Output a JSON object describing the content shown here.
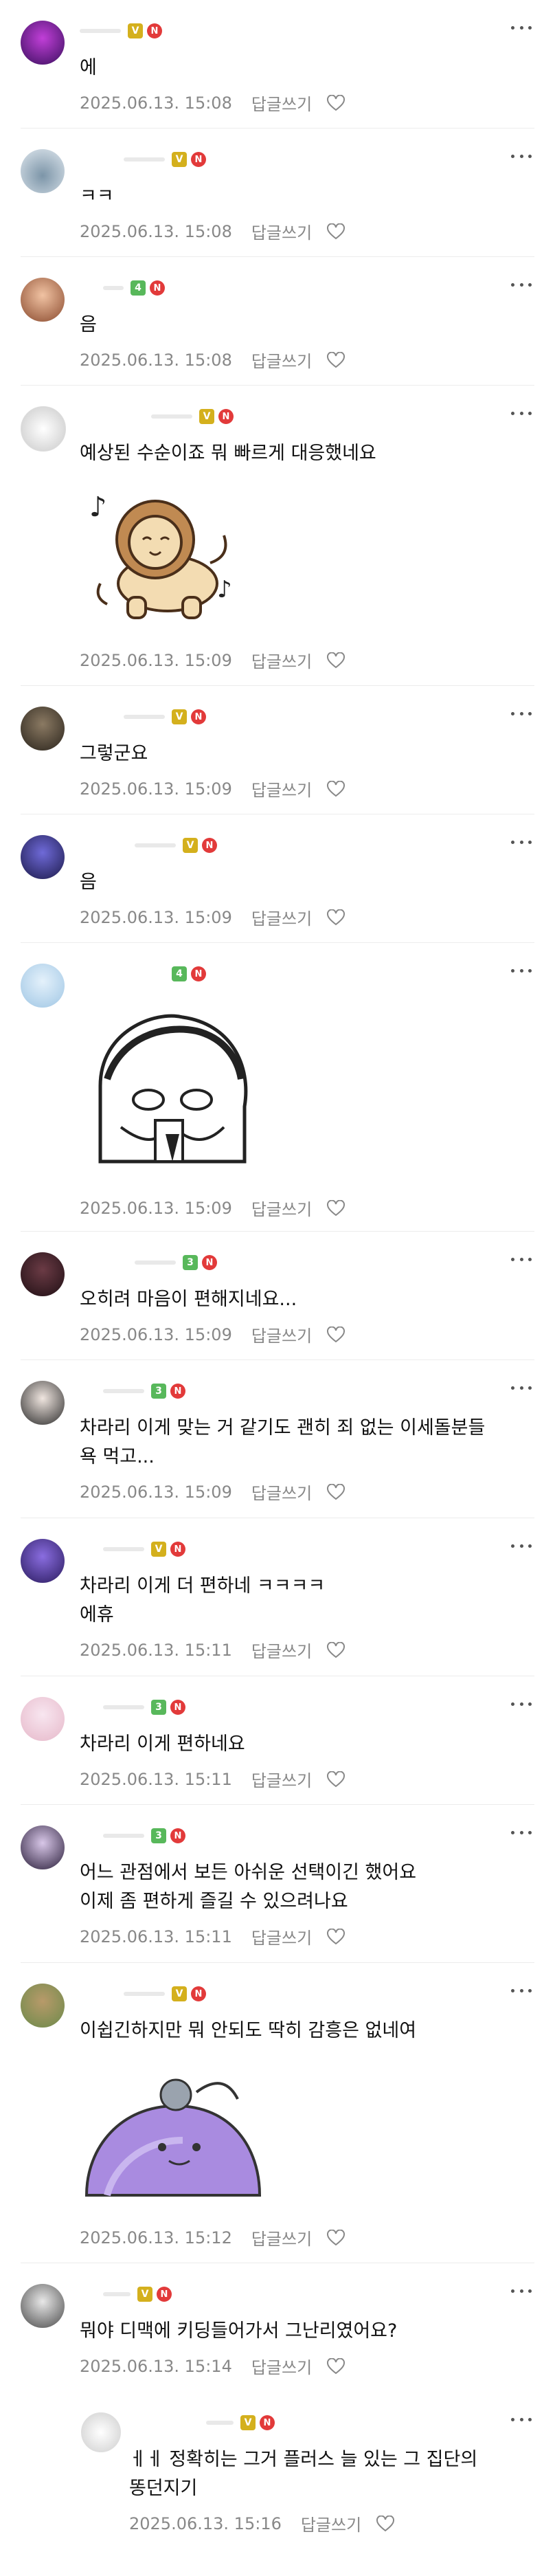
{
  "reply_label": "답글쓰기",
  "comments": [
    {
      "text": "에",
      "time": "2025.06.13. 15:08",
      "level": "V"
    },
    {
      "text": "ㅋㅋ",
      "time": "2025.06.13. 15:08",
      "level": "V"
    },
    {
      "text": "음",
      "time": "2025.06.13. 15:08",
      "level": "4"
    },
    {
      "text": "예상된 수순이죠 뭐 빠르게 대응했네요",
      "time": "2025.06.13. 15:09",
      "level": "V"
    },
    {
      "text": "그렇군요",
      "time": "2025.06.13. 15:09",
      "level": "V"
    },
    {
      "text": "음",
      "time": "2025.06.13. 15:09",
      "level": "V"
    },
    {
      "text": "",
      "time": "2025.06.13. 15:09",
      "level": "4"
    },
    {
      "text": "오히려 마음이 편해지네요...",
      "time": "2025.06.13. 15:09",
      "level": "3"
    },
    {
      "text": "차라리 이게 맞는 거 같기도 괜히 죄 없는 이세돌분들\n욕 먹고...",
      "time": "2025.06.13. 15:09",
      "level": "3"
    },
    {
      "text": "차라리 이게 더 편하네 ㅋㅋㅋㅋ\n에휴",
      "time": "2025.06.13. 15:11",
      "level": "V"
    },
    {
      "text": "차라리 이게 편하네요",
      "time": "2025.06.13. 15:11",
      "level": "3"
    },
    {
      "text": "어느 관점에서 보든 아쉬운 선택이긴 했어요\n이제 좀 편하게 즐길 수 있으려나요",
      "time": "2025.06.13. 15:11",
      "level": "3"
    },
    {
      "text": "이쉽긴하지만 뭐 안되도 딱히 감흥은 없네여",
      "time": "2025.06.13. 15:12",
      "level": "V"
    },
    {
      "text": "뭐야 디맥에 키딩들어가서 그난리였어요?",
      "time": "2025.06.13. 15:14",
      "level": "V"
    },
    {
      "text": "ㅔㅔ 정확히는 그거 플러스 늘 있는 그 집단의\n똥던지기",
      "time": "2025.06.13. 15:16",
      "level": "V"
    }
  ]
}
